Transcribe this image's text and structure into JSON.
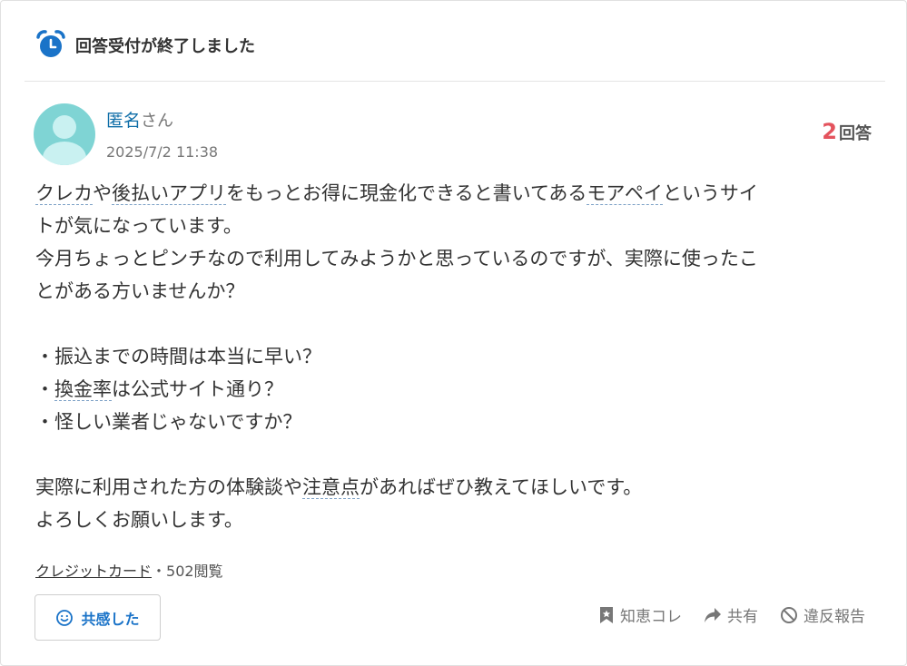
{
  "status": {
    "text": "回答受付が終了しました"
  },
  "question": {
    "user": {
      "name": "匿名",
      "suffix": "さん"
    },
    "timestamp": "2025/7/2 11:38",
    "answers": {
      "count": "2",
      "label": "回答"
    },
    "body": {
      "line1": {
        "p1": "クレカ",
        "p2": "や",
        "p3": "後払いアプリ",
        "p4": "をもっとお得に現金化できると書いてある",
        "p5": "モアペイ",
        "p6": "というサイ"
      },
      "line2": "トが気になっています。",
      "line3": "今月ちょっとピンチなので利用してみようかと思っているのですが、実際に使ったこ",
      "line4": "とがある方いませんか？",
      "line5": "・振込までの時間は本当に早い？",
      "line6": {
        "p1": "・",
        "p2": "換金率",
        "p3": "は公式サイト通り？"
      },
      "line7": "・怪しい業者じゃないですか？",
      "line8": {
        "p1": "実際に利用された方の体験談や",
        "p2": "注意点",
        "p3": "があればぜひ教えてほしいです。"
      },
      "line9": "よろしくお願いします。"
    },
    "category": "クレジットカード",
    "views": "・502閲覧"
  },
  "actions": {
    "empathy": "共感した",
    "save": "知恵コレ",
    "share": "共有",
    "report": "違反報告"
  },
  "colors": {
    "alarm_blue": "#1a73c8",
    "avatar": "#7fd4d4",
    "count_red": "#e4535d",
    "link_blue": "#0f6ea8"
  },
  "icons": [
    "alarm-clock-icon",
    "avatar-icon",
    "smile-icon",
    "bookmark-icon",
    "share-arrow-icon",
    "prohibit-icon"
  ]
}
